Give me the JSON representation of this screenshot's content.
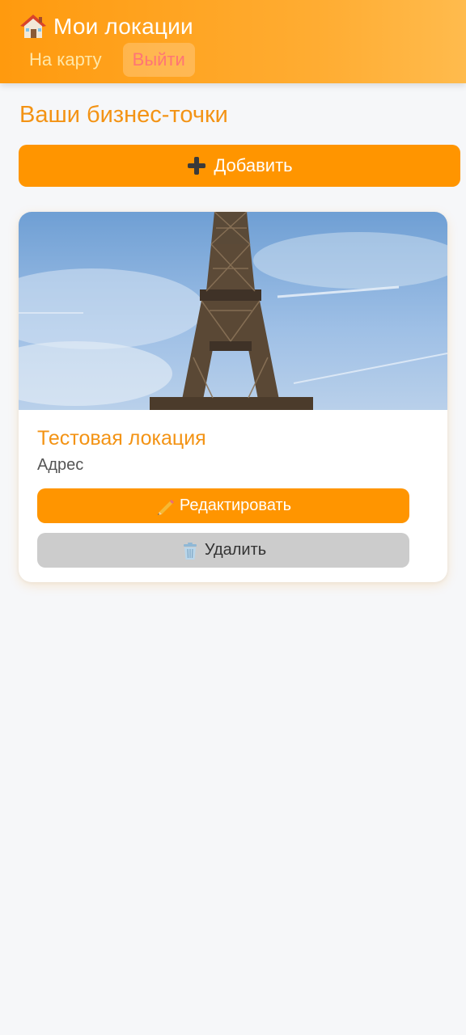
{
  "header": {
    "title": "Мои локации",
    "icon": "house-icon",
    "nav": {
      "map_label": "На карту",
      "logout_label": "Выйти"
    }
  },
  "main": {
    "section_title": "Ваши бизнес-точки",
    "add_button_label": "Добавить",
    "add_button_icon": "plus-icon"
  },
  "locations": [
    {
      "image": "eiffel-tower-photo",
      "title": "Тестовая локация",
      "address": "Адрес",
      "edit_label": "Редактировать",
      "edit_icon": "pencil-icon",
      "delete_label": "Удалить",
      "delete_icon": "trash-icon"
    }
  ],
  "colors": {
    "accent": "#ff9500",
    "title_orange": "#f39314",
    "logout_red": "#ff7575",
    "delete_gray": "#cccccc",
    "background": "#f6f7f9"
  }
}
